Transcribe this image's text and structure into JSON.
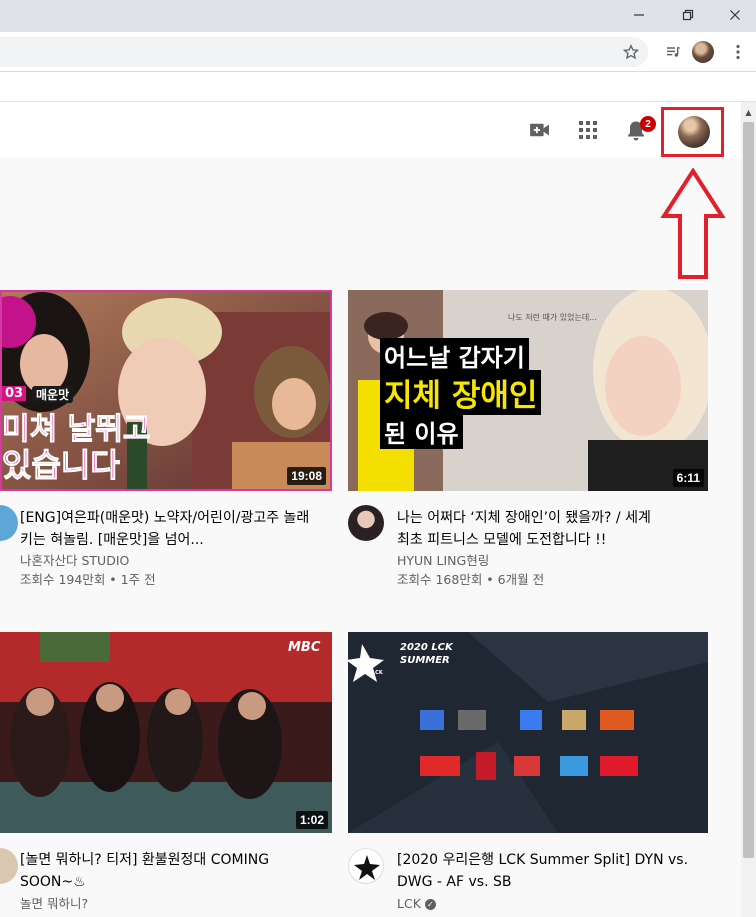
{
  "window": {
    "minimize_icon": "minimize-icon",
    "maximize_icon": "restore-icon",
    "close_icon": "close-icon"
  },
  "toolbar": {
    "bookmark_icon": "star-icon",
    "media_icon": "media-queue-icon",
    "menu_icon": "kebab-menu-icon"
  },
  "header": {
    "create_icon": "video-camera-add-icon",
    "apps_icon": "apps-grid-icon",
    "notifications_icon": "bell-icon",
    "notification_count": "2"
  },
  "colors": {
    "annotation_red": "#e0202a",
    "badge_red": "#cc0000",
    "meta_gray": "#606060"
  },
  "videos": [
    {
      "title": "[ENG]여은파(매운맛) 노약자/어린이/광고주 놀래키는 혀놀림. [매운맛]을 넘어...",
      "channel": "나혼자산다 STUDIO",
      "stats": "조회수 194만회 • 1주 전",
      "duration": "19:08",
      "overlay": [
        "03",
        "매운맛",
        "미쳐 날뛰고",
        "있습니다"
      ]
    },
    {
      "title": "나는 어쩌다 ‘지체 장애인’이 됐을까? / 세계 최초 피트니스 모델에 도전합니다 !!",
      "channel": "HYUN LING현링",
      "stats": "조회수 168만회 • 6개월 전",
      "duration": "6:11",
      "overlay": [
        "나도 저런 때가 있었는데...",
        "어느날 갑자기",
        "지체 장애인",
        "된 이유"
      ]
    },
    {
      "title": "[놀면 뭐하니? 티저] 환불원정대 COMING SOON~♨",
      "channel": "놀면 뭐하니?",
      "stats": "",
      "duration": "1:02",
      "overlay": [
        "MBC"
      ]
    },
    {
      "title": "[2020 우리은행 LCK Summer Split] DYN vs. DWG - AF vs. SB",
      "channel": "LCK",
      "stats": "",
      "duration": "",
      "overlay": [
        "2020 LCK",
        "SUMMER",
        "LCK"
      ]
    }
  ]
}
